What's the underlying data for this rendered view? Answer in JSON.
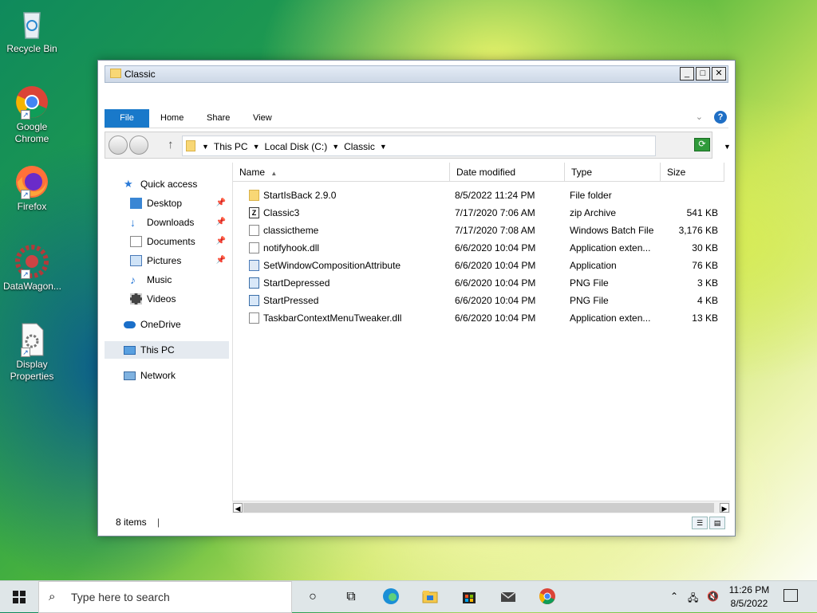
{
  "desktop": {
    "icons": [
      {
        "label": "Recycle Bin",
        "icon": "recycle-bin-icon"
      },
      {
        "label": "Google Chrome",
        "icon": "chrome-icon"
      },
      {
        "label": "Firefox",
        "icon": "firefox-icon"
      },
      {
        "label": "DataWagon...",
        "icon": "datawagon-icon"
      },
      {
        "label": "Display Properties",
        "icon": "display-properties-icon"
      }
    ]
  },
  "window": {
    "title": "Classic",
    "buttons": {
      "minimize": "_",
      "maximize": "□",
      "close": "✕"
    },
    "ribbon": {
      "tabs": [
        "File",
        "Home",
        "Share",
        "View"
      ],
      "help": "?"
    },
    "address": {
      "crumbs": [
        "This PC",
        "Local Disk (C:)",
        "Classic"
      ]
    },
    "nav": {
      "quick_access": "Quick access",
      "items": [
        "Desktop",
        "Downloads",
        "Documents",
        "Pictures",
        "Music",
        "Videos"
      ],
      "onedrive": "OneDrive",
      "this_pc": "This PC",
      "network": "Network"
    },
    "columns": [
      "Name",
      "Date modified",
      "Type",
      "Size"
    ],
    "files": [
      {
        "name": "StartIsBack 2.9.0",
        "date": "8/5/2022 11:24 PM",
        "type": "File folder",
        "size": "",
        "icon": "folder"
      },
      {
        "name": "Classic3",
        "date": "7/17/2020 7:06 AM",
        "type": "zip Archive",
        "size": "541 KB",
        "icon": "zip"
      },
      {
        "name": "classictheme",
        "date": "7/17/2020 7:08 AM",
        "type": "Windows Batch File",
        "size": "3,176 KB",
        "icon": "file"
      },
      {
        "name": "notifyhook.dll",
        "date": "6/6/2020 10:04 PM",
        "type": "Application exten...",
        "size": "30 KB",
        "icon": "file"
      },
      {
        "name": "SetWindowCompositionAttribute",
        "date": "6/6/2020 10:04 PM",
        "type": "Application",
        "size": "76 KB",
        "icon": "app"
      },
      {
        "name": "StartDepressed",
        "date": "6/6/2020 10:04 PM",
        "type": "PNG File",
        "size": "3 KB",
        "icon": "png"
      },
      {
        "name": "StartPressed",
        "date": "6/6/2020 10:04 PM",
        "type": "PNG File",
        "size": "4 KB",
        "icon": "png"
      },
      {
        "name": "TaskbarContextMenuTweaker.dll",
        "date": "6/6/2020 10:04 PM",
        "type": "Application exten...",
        "size": "13 KB",
        "icon": "file"
      }
    ],
    "status": "8 items"
  },
  "taskbar": {
    "search_placeholder": "Type here to search",
    "time": "11:26 PM",
    "date": "8/5/2022"
  },
  "colors": {
    "accent": "#1979ca",
    "folder": "#f8d775"
  }
}
